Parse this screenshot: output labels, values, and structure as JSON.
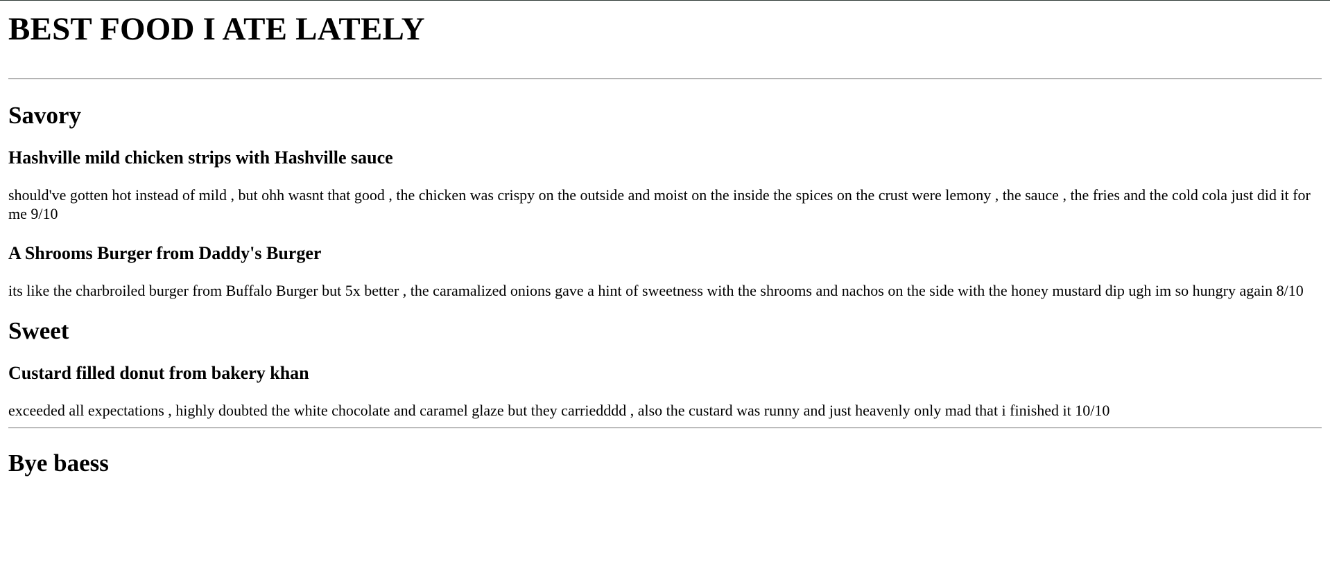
{
  "title": "BEST FOOD I ATE LATELY",
  "sections": [
    {
      "heading": "Savory",
      "items": [
        {
          "title": "Hashville mild chicken strips with Hashville sauce",
          "description": "should've gotten hot instead of mild , but ohh wasnt that good , the chicken was crispy on the outside and moist on the inside the spices on the crust were lemony , the sauce , the fries and the cold cola just did it for me 9/10"
        },
        {
          "title": "A Shrooms Burger from Daddy's Burger",
          "description": "its like the charbroiled burger from Buffalo Burger but 5x better , the caramalized onions gave a hint of sweetness with the shrooms and nachos on the side with the honey mustard dip ugh im so hungry again 8/10"
        }
      ]
    },
    {
      "heading": "Sweet",
      "items": [
        {
          "title": "Custard filled donut from bakery khan",
          "description": "exceeded all expectations , highly doubted the white chocolate and caramel glaze but they carriedddd , also the custard was runny and just heavenly only mad that i finished it 10/10"
        }
      ]
    }
  ],
  "footer": "Bye baess"
}
